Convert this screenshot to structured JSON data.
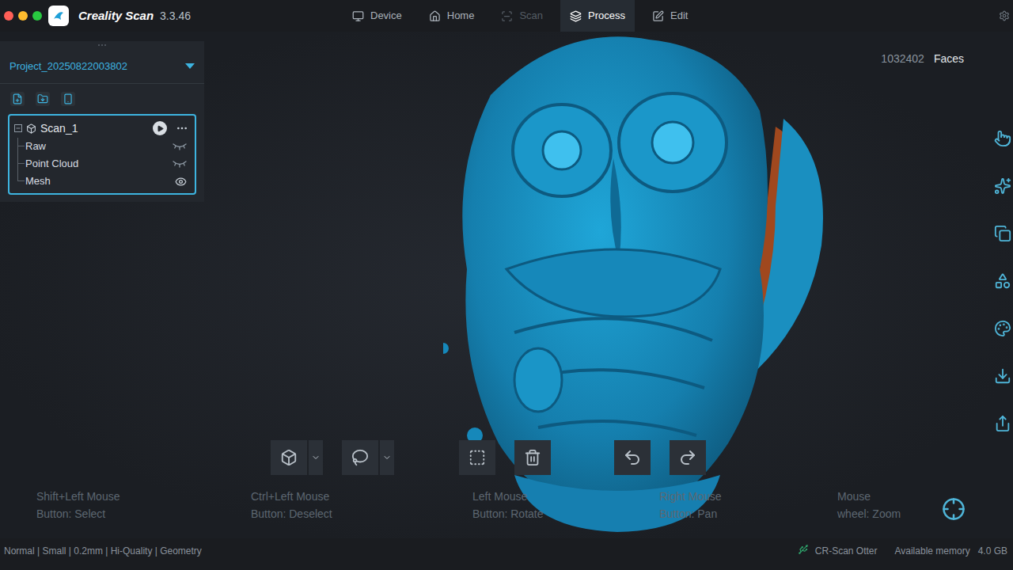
{
  "window": {
    "app": "Creality Scan",
    "version": "3.3.46"
  },
  "nav": [
    {
      "label": "Device",
      "selected": false,
      "disabled": false
    },
    {
      "label": "Home",
      "selected": false,
      "disabled": false
    },
    {
      "label": "Scan",
      "selected": false,
      "disabled": true
    },
    {
      "label": "Process",
      "selected": true,
      "disabled": false
    },
    {
      "label": "Edit",
      "selected": false,
      "disabled": false
    }
  ],
  "project": {
    "name": "Project_20250822003802"
  },
  "tree": {
    "name": "Scan_1",
    "expanded": true,
    "items": [
      {
        "label": "Raw",
        "visible": false
      },
      {
        "label": "Point Cloud",
        "visible": false
      },
      {
        "label": "Mesh",
        "visible": true
      }
    ]
  },
  "viewport": {
    "count": "1032402",
    "count_label": "Faces"
  },
  "hints": [
    {
      "line1": "Shift+Left Mouse",
      "line2": "Button:  Select"
    },
    {
      "line1": "Ctrl+Left Mouse",
      "line2": "Button:  Deselect"
    },
    {
      "line1": "Left Mouse",
      "line2": "Button:  Rotate"
    },
    {
      "line1": "Right Mouse",
      "line2": "Button:  Pan"
    },
    {
      "line1": "Mouse",
      "line2": "wheel:  Zoom"
    }
  ],
  "status": {
    "settings": "Normal | Small | 0.2mm | Hi-Quality | Geometry",
    "device": "CR-Scan Otter",
    "memory_label": "Available memory",
    "memory": "4.0 GB"
  }
}
